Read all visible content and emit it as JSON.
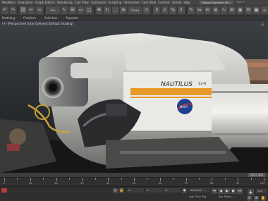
{
  "menu": {
    "items": [
      "Modifiers",
      "Animation",
      "Graph Editors",
      "Rendering",
      "Civil View",
      "Customize",
      "Scripting",
      "Interactive",
      "Civil View",
      "Content",
      "Arnold",
      "Help"
    ],
    "workspace": "Design Standard (W...",
    "user": "Sign In"
  },
  "ribbon": {
    "tabs": [
      "Modeling",
      "Freeform",
      "Selection",
      "Populate"
    ]
  },
  "viewport": {
    "label": "[+] [Perspective] [User Defined] [Default Shading]",
    "decal_text": "NAUTILUS",
    "decal_suffix": "12-6"
  },
  "timeline": {
    "slider_label": "100 / 100",
    "ticks": [
      "0",
      "10",
      "20",
      "30",
      "40",
      "50",
      "60",
      "70",
      "80",
      "90",
      "100"
    ]
  },
  "status": {
    "add_time_tag": "Add Time Tag",
    "frame_field": "100",
    "selected": "Selected",
    "key_filters": "Key Filters..."
  },
  "colors": {
    "accent_orange": "#e89a2a",
    "nasa_blue": "#1f3f8f",
    "status_red": "#b83a3a"
  }
}
